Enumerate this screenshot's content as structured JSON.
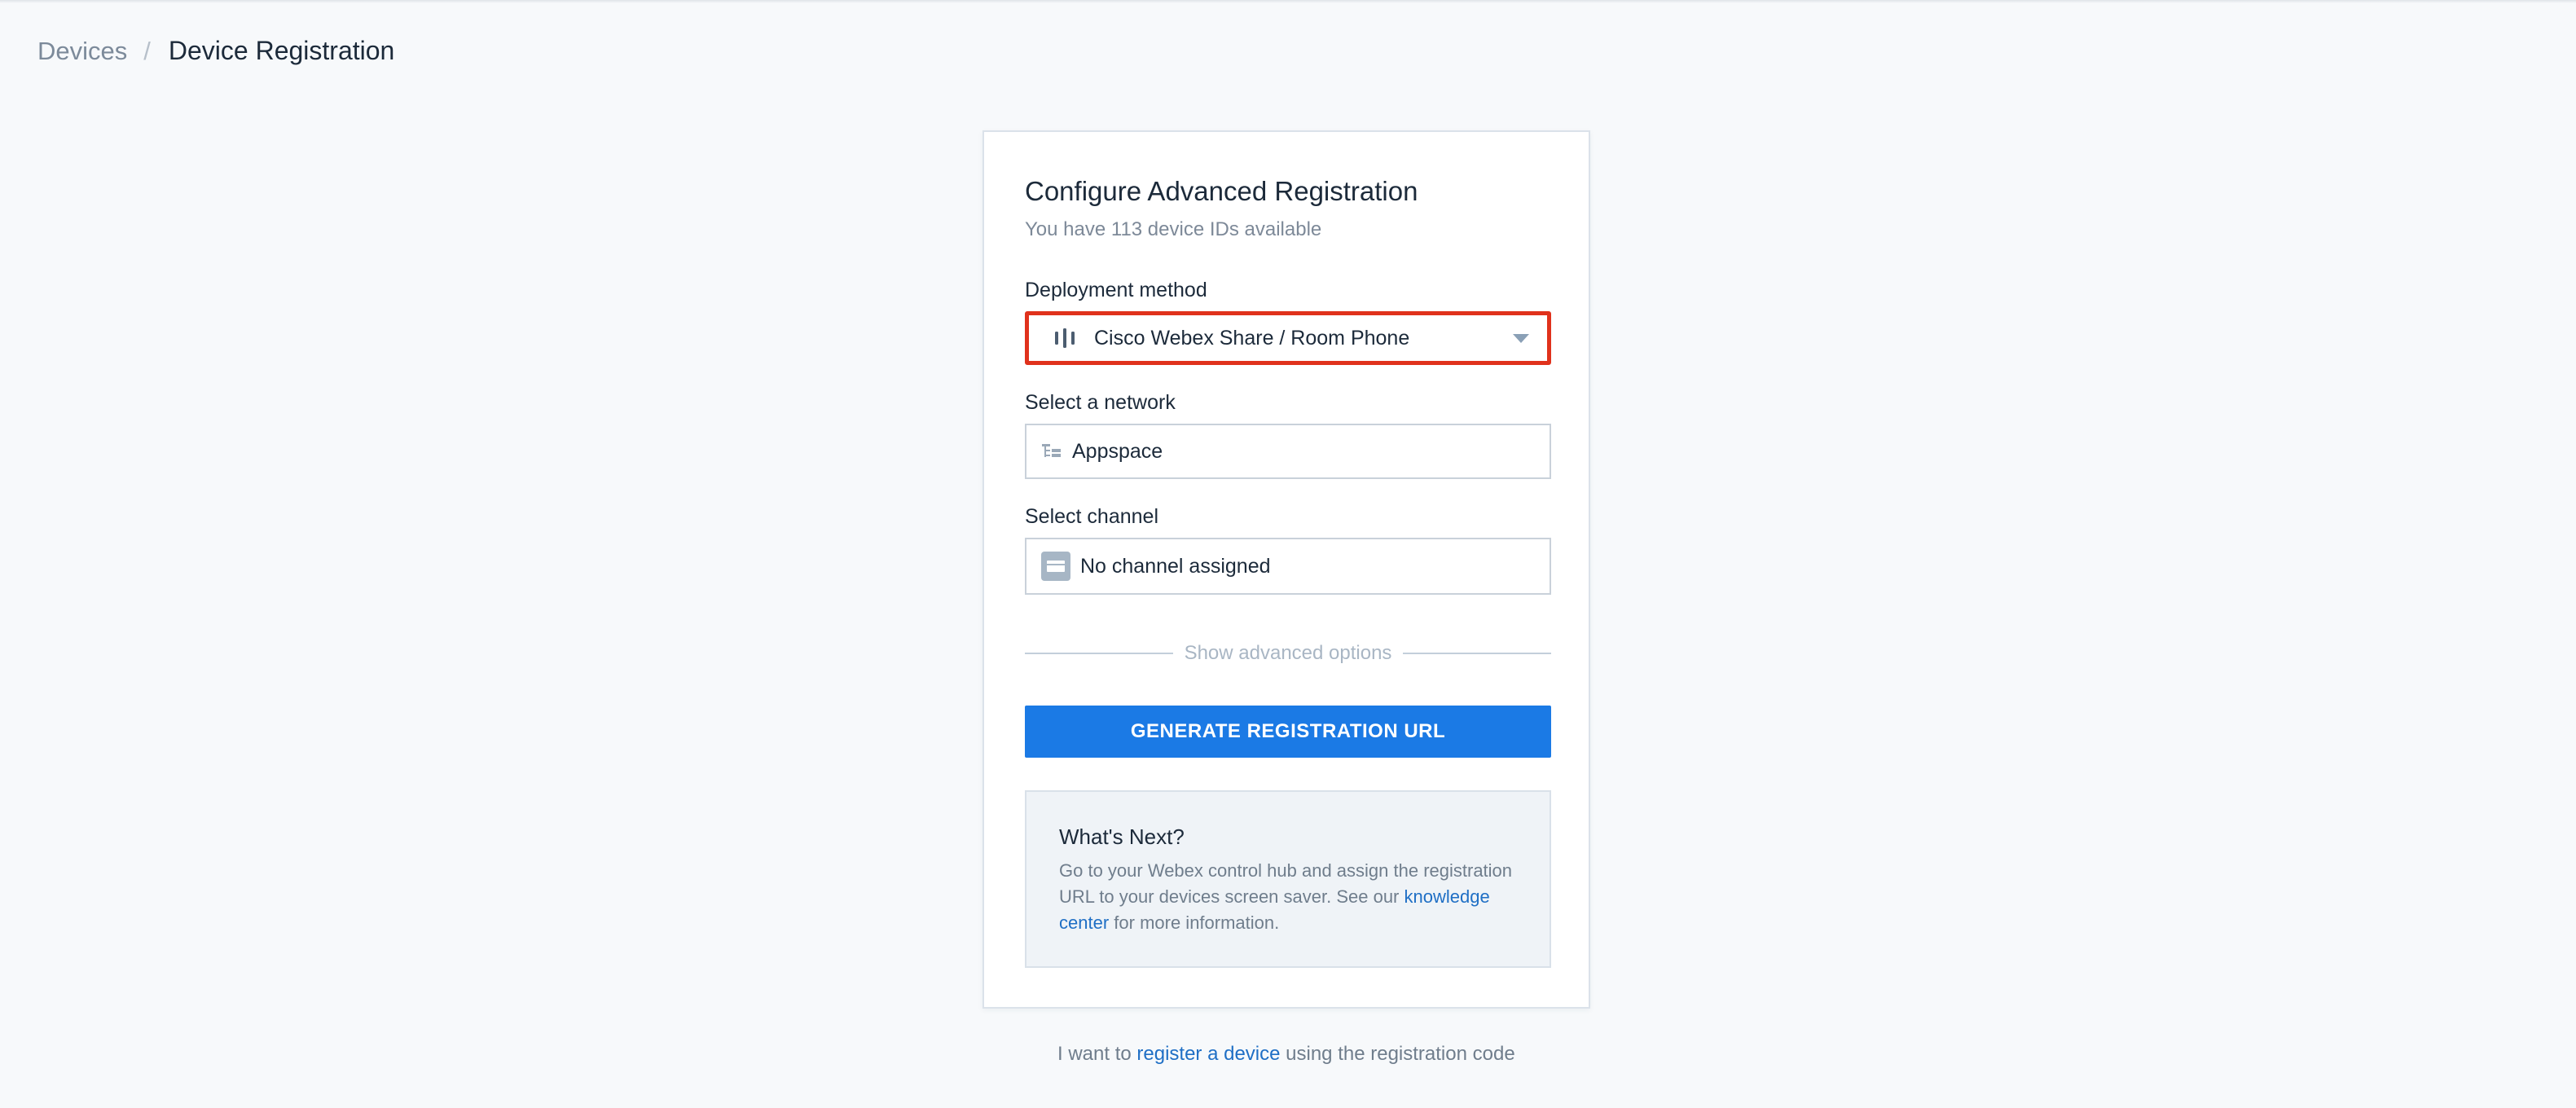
{
  "breadcrumb": {
    "parent": "Devices",
    "separator": "/",
    "current": "Device Registration"
  },
  "card": {
    "title": "Configure Advanced Registration",
    "subtitle": "You have 113 device IDs available",
    "deployment": {
      "label": "Deployment method",
      "value": "Cisco Webex Share / Room Phone",
      "icon": "device-bars-icon",
      "highlight_color": "#e0321c"
    },
    "network": {
      "label": "Select a network",
      "value": "Appspace",
      "icon": "network-tree-icon"
    },
    "channel": {
      "label": "Select channel",
      "value": "No channel assigned",
      "icon": "channel-thumbnail-icon"
    },
    "advanced_toggle": "Show advanced options",
    "primary_button": "GENERATE REGISTRATION URL",
    "whats_next": {
      "title": "What's Next?",
      "text_before": "Go to your Webex control hub and assign the registration URL to your devices screen saver. See our",
      "link": "knowledge center",
      "text_after": "for more information."
    }
  },
  "footer": {
    "text_before": "I want to",
    "link": "register a device",
    "text_after": "using the registration code"
  },
  "colors": {
    "accent": "#1b7ae5",
    "link": "#1f6fc5",
    "page_background": "#f7f9fb"
  }
}
